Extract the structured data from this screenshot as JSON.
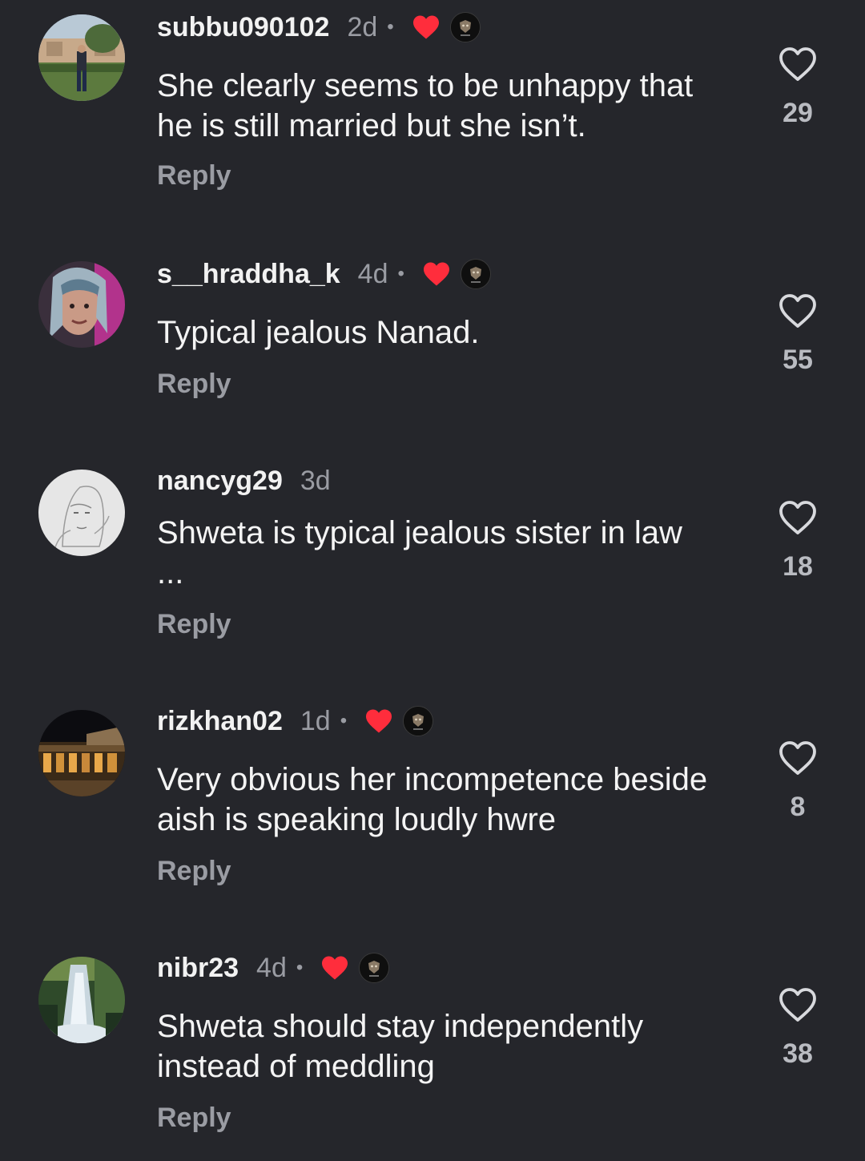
{
  "comments": [
    {
      "username": "subbu090102",
      "time": "2d",
      "dot": "•",
      "creator_liked": true,
      "text": "She clearly seems to be unhappy that\nhe is still married but she isn’t.",
      "reply_label": "Reply",
      "likes": "29"
    },
    {
      "username": "s__hraddha_k",
      "time": "4d",
      "dot": "•",
      "creator_liked": true,
      "text": "Typical jealous Nanad.",
      "reply_label": "Reply",
      "likes": "55"
    },
    {
      "username": "nancyg29",
      "time": "3d",
      "dot": "",
      "creator_liked": false,
      "text": "Shweta is typical jealous sister in law\n...",
      "reply_label": "Reply",
      "likes": "18"
    },
    {
      "username": "rizkhan02",
      "time": "1d",
      "dot": "•",
      "creator_liked": true,
      "text": "Very obvious her incompetence beside\naish is speaking loudly hwre",
      "reply_label": "Reply",
      "likes": "8"
    },
    {
      "username": "nibr23",
      "time": "4d",
      "dot": "•",
      "creator_liked": true,
      "text": "Shweta should stay independently\ninstead of meddling",
      "reply_label": "Reply",
      "likes": "38"
    }
  ],
  "colors": {
    "background": "#25262b",
    "liked_heart": "#ff2d3c",
    "secondary_text": "#9a9ca3"
  },
  "icons": {
    "like": "heart-outline-icon",
    "creator_like": "heart-filled-icon"
  }
}
